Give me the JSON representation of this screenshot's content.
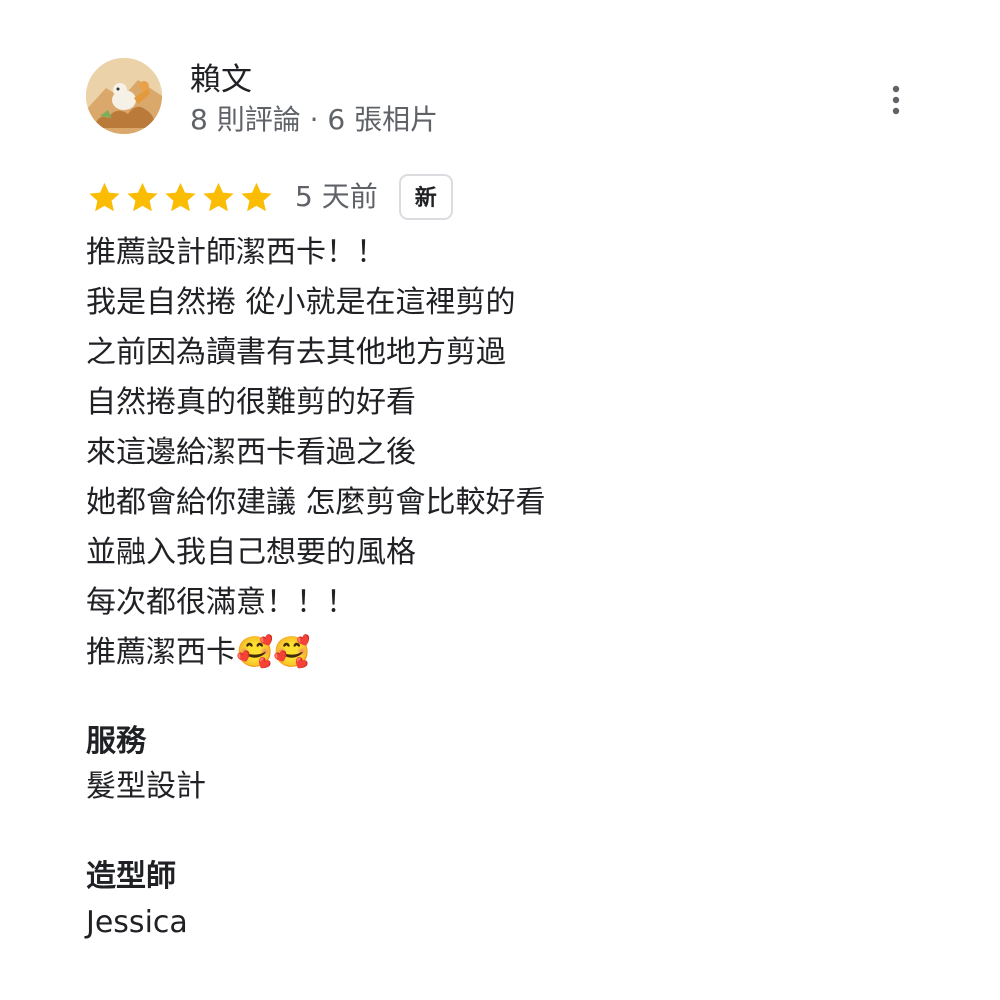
{
  "reviewer": {
    "name": "賴文",
    "meta": "8 則評論 · 6 張相片",
    "avatar_icon": "avatar-dinosaur-icon"
  },
  "menu": {
    "icon": "more-vert-icon"
  },
  "rating": {
    "stars": 5,
    "max": 5,
    "star_color": "#fbbc04",
    "date": "5 天前",
    "badge": "新"
  },
  "review": {
    "lines": [
      "推薦設計師潔西卡！！",
      "我是自然捲 從小就是在這裡剪的",
      "之前因為讀書有去其他地方剪過",
      "自然捲真的很難剪的好看",
      "來這邊給潔西卡看過之後",
      "她都會給你建議 怎麼剪會比較好看",
      "並融入我自己想要的風格",
      "每次都很滿意！！！",
      "推薦潔西卡🥰🥰"
    ]
  },
  "details": {
    "service_title": "服務",
    "service_value": "髮型設計",
    "stylist_title": "造型師",
    "stylist_value": "Jessica"
  }
}
